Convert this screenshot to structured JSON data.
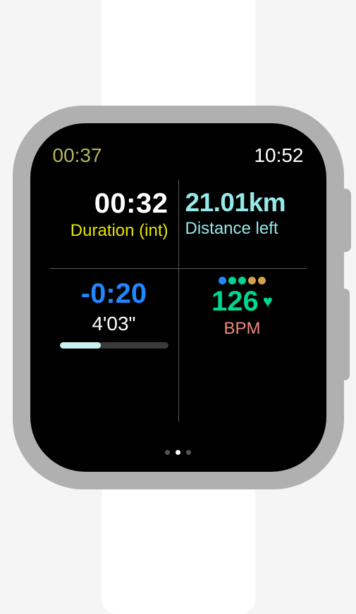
{
  "status": {
    "elapsed": "00:37",
    "clock": "10:52"
  },
  "metrics": {
    "duration": {
      "value": "00:32",
      "label": "Duration (int)"
    },
    "distance": {
      "value": "21.01km",
      "label": "Distance left"
    },
    "pace": {
      "diff": "-0:20",
      "current": "4'03\"",
      "progress_pct": 38
    },
    "heart": {
      "value": "126",
      "label": "BPM",
      "zones": [
        "#1f87ff",
        "#00d68f",
        "#00d68f",
        "#d4a04a",
        "#d4a04a"
      ]
    }
  },
  "pagination": {
    "count": 3,
    "active": 1
  }
}
